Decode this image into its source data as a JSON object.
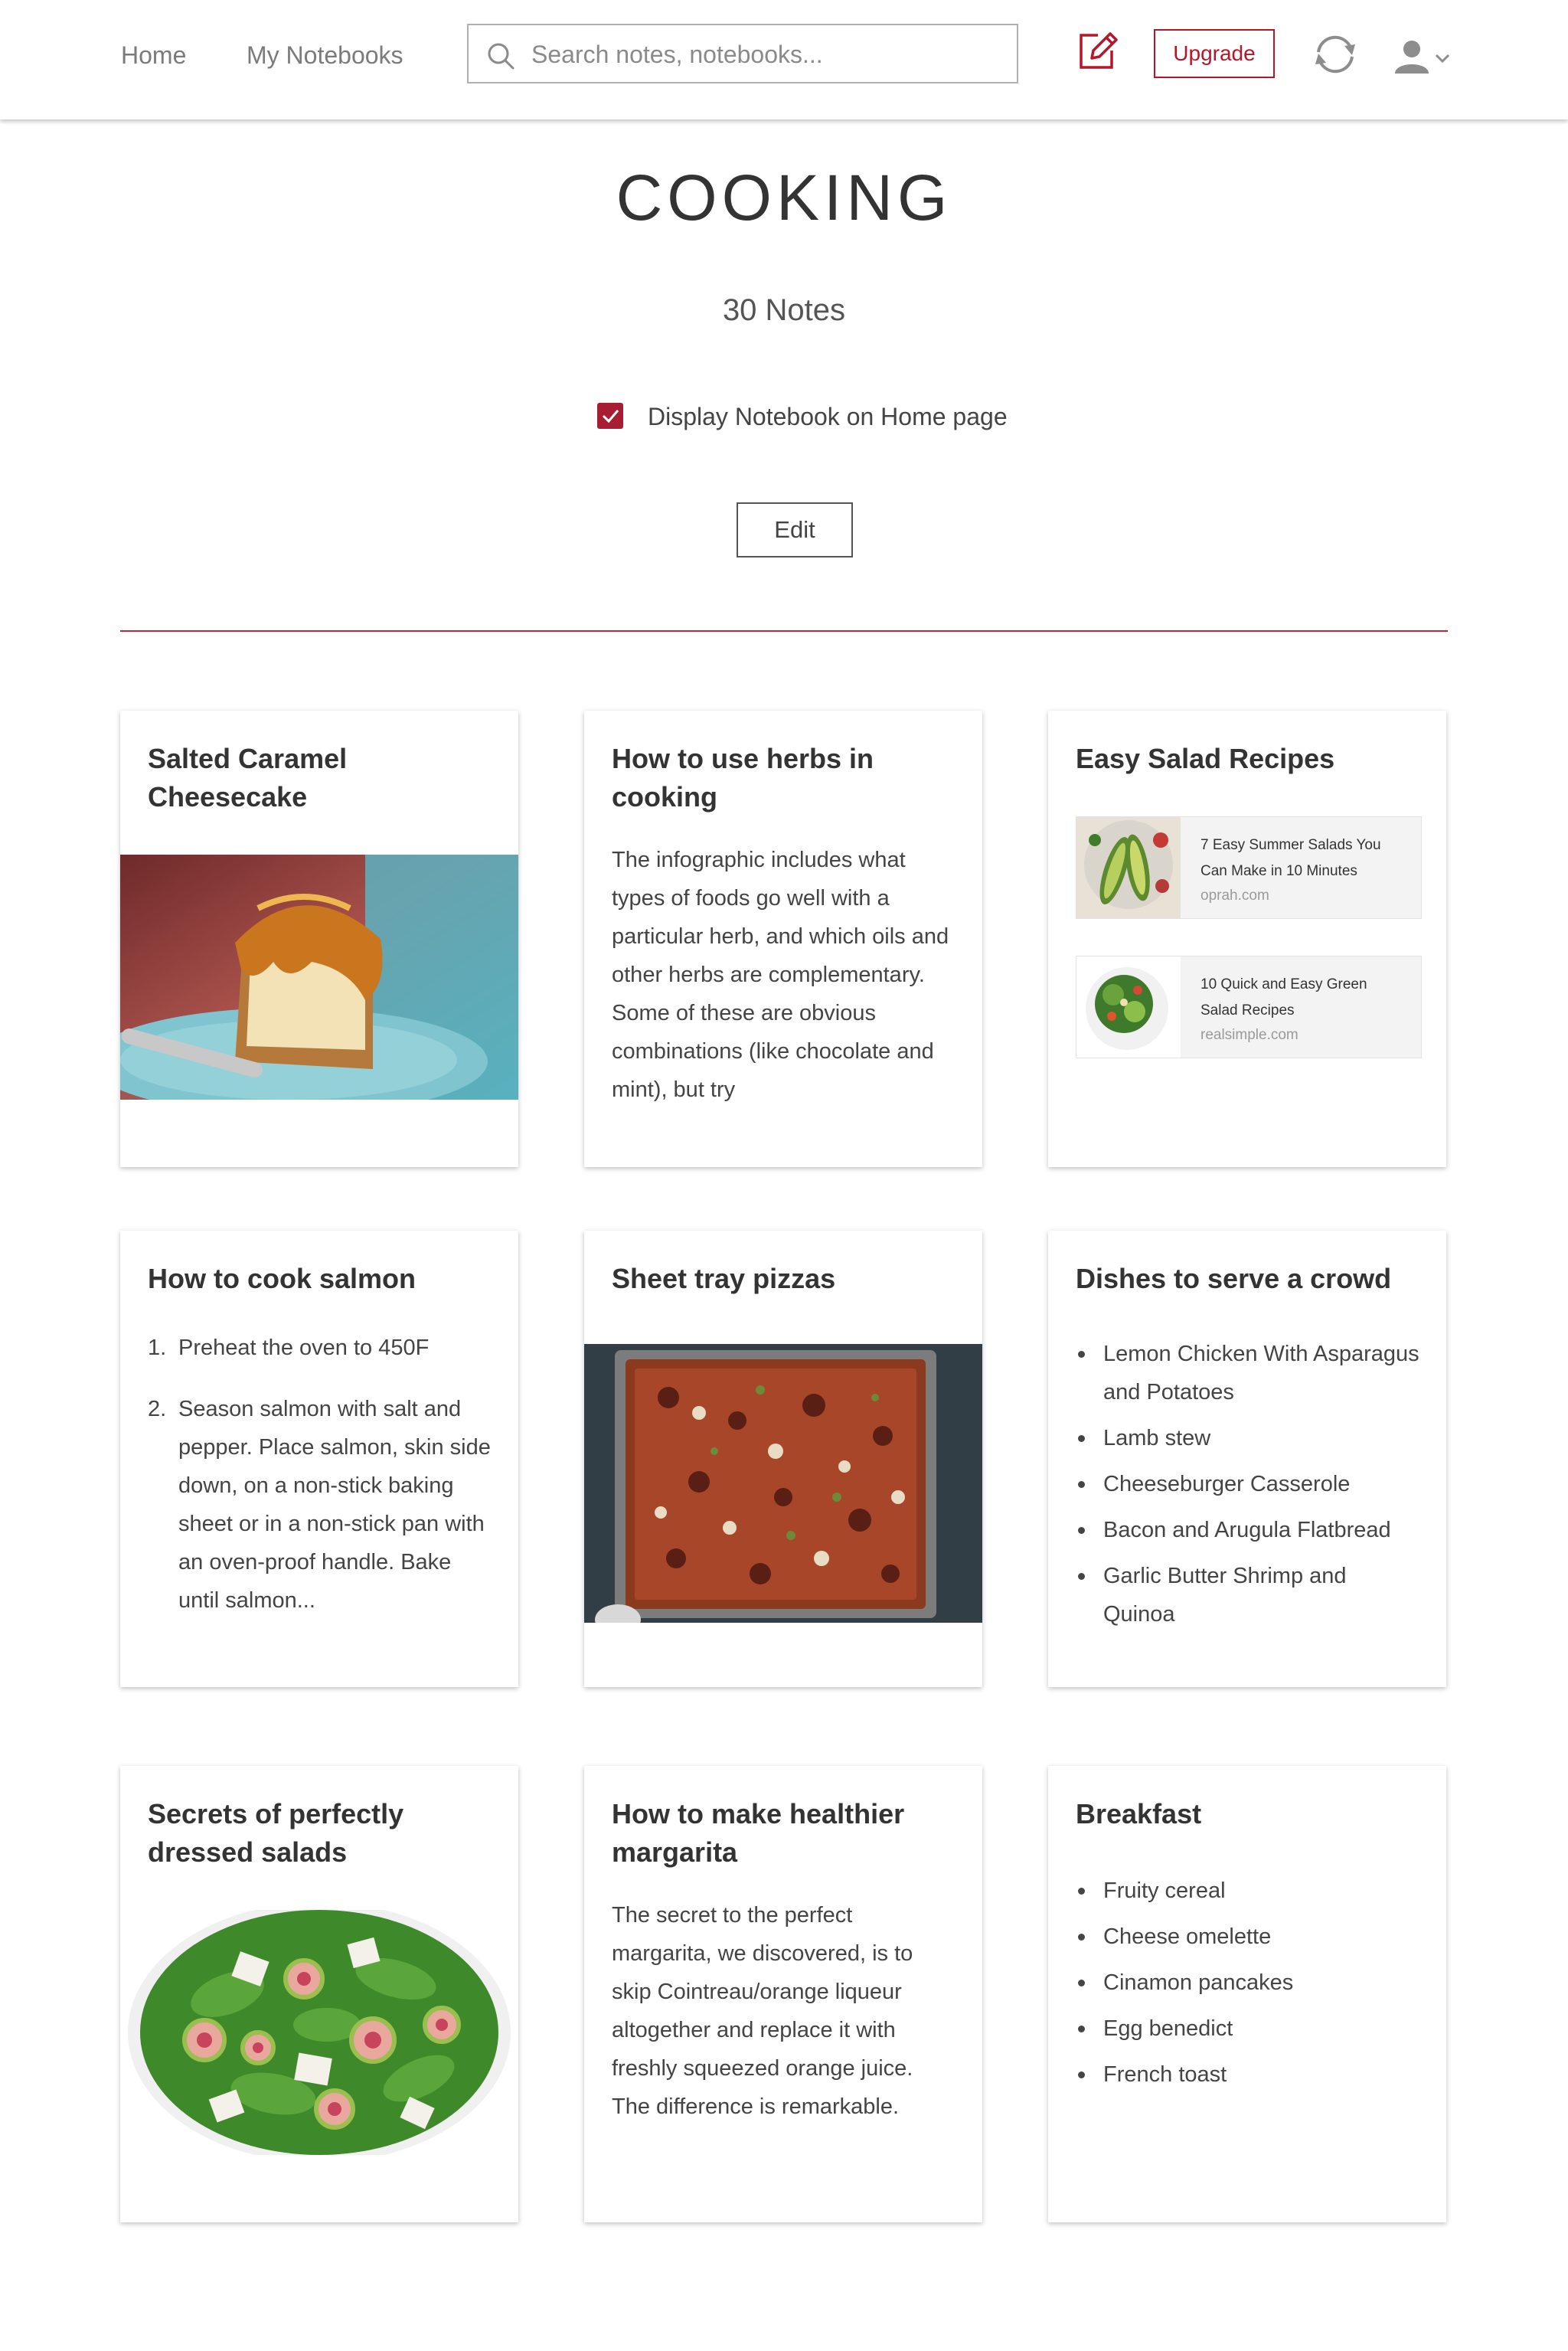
{
  "nav": {
    "home": "Home",
    "my_notebooks": "My Notebooks",
    "search_placeholder": "Search notes, notebooks...",
    "upgrade": "Upgrade",
    "icons": [
      "new-note-icon",
      "sync-icon",
      "user-icon",
      "chevron-down-icon"
    ]
  },
  "notebook": {
    "title": "COOKING",
    "count": "30 Notes",
    "display_on_home_label": "Display Notebook on Home page",
    "display_on_home_checked": true,
    "edit_label": "Edit"
  },
  "colors": {
    "accent": "#b5172a",
    "divider": "#c1283d",
    "checkbox": "#a71d31"
  },
  "cards": [
    {
      "title": "Salted Caramel Cheesecake"
    },
    {
      "title": "How to use herbs in cooking",
      "body": "The infographic includes what types of foods go well with a particular herb, and which oils and other herbs are complementary. Some of these are obvious combinations (like chocolate and mint), but try"
    },
    {
      "title": "Easy Salad Recipes",
      "links": [
        {
          "title": "7 Easy Summer Salads You Can Make in 10 Minutes",
          "source": "oprah.com"
        },
        {
          "title": "10 Quick and Easy Green Salad Recipes",
          "source": "realsimple.com"
        }
      ]
    },
    {
      "title": "How to cook salmon",
      "steps": [
        {
          "num": "1.",
          "text": "Preheat the oven to 450F"
        },
        {
          "num": "2.",
          "text": "Season salmon with salt and pepper. Place salmon, skin side down, on a non-stick baking sheet or in a non-stick pan with an oven-proof handle. Bake until salmon..."
        }
      ]
    },
    {
      "title": "Sheet tray pizzas"
    },
    {
      "title": "Dishes to serve a crowd",
      "items": [
        "Lemon Chicken With Asparagus and Potatoes",
        "Lamb stew",
        "Cheeseburger Casserole",
        "Bacon and Arugula Flatbread",
        "Garlic Butter Shrimp and Quinoa"
      ]
    },
    {
      "title": "Secrets of perfectly dressed salads"
    },
    {
      "title": "How to make healthier margarita",
      "body": "The secret to the perfect margarita, we discovered, is to skip Cointreau/orange liqueur altogether and replace it with freshly squeezed orange juice. The difference is remarkable."
    },
    {
      "title": "Breakfast",
      "items": [
        "Fruity cereal",
        "Cheese omelette",
        "Cinamon pancakes",
        "Egg benedict",
        "French toast"
      ]
    }
  ]
}
